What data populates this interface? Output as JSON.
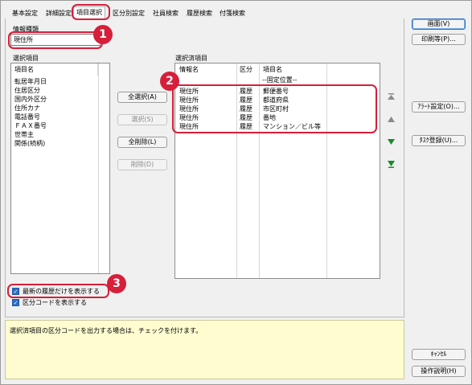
{
  "tabs": [
    "基本設定",
    "詳細設定",
    "項目選択",
    "区分別設定",
    "社員検索",
    "履歴検索",
    "付箋検索"
  ],
  "info_type": {
    "label": "情報種類",
    "value": "現住所"
  },
  "left_list": {
    "label": "選択項目",
    "header": "項目名",
    "items": [
      "転居年月日",
      "住居区分",
      "国内外区分",
      "住所カナ",
      "電話番号",
      "ＦＡＸ番号",
      "世帯主",
      "関係(続柄)"
    ]
  },
  "middle_buttons": {
    "select_all": "全選択(A)",
    "select": "選択(S)",
    "delete_all": "全削除(L)",
    "delete": "削除(D)"
  },
  "right_list": {
    "label": "選択済項目",
    "headers": {
      "info": "情報名",
      "category": "区分",
      "item": "項目名"
    },
    "fixed_position": "--固定位置--",
    "rows": [
      {
        "info": "現住所",
        "category": "履歴",
        "item": "郵便番号"
      },
      {
        "info": "現住所",
        "category": "履歴",
        "item": "都道府県"
      },
      {
        "info": "現住所",
        "category": "履歴",
        "item": "市区町村"
      },
      {
        "info": "現住所",
        "category": "履歴",
        "item": "番地"
      },
      {
        "info": "現住所",
        "category": "履歴",
        "item": "マンション／ビル等"
      }
    ]
  },
  "checkboxes": {
    "latest_history": "最新の履歴だけを表示する",
    "show_category_code": "区分コードを表示する"
  },
  "hint": "選択済項目の区分コードを出力する場合は、チェックを付けます。",
  "side_buttons": {
    "screen": "画面(V)",
    "print": "印刷等(P)...",
    "alert": "ｱﾗｰﾄ設定(O)...",
    "task": "ﾀｽｸ登録(U)...",
    "cancel": "ｷｬﾝｾﾙ",
    "help": "操作説明(H)"
  },
  "callouts": [
    "1",
    "2",
    "3"
  ]
}
